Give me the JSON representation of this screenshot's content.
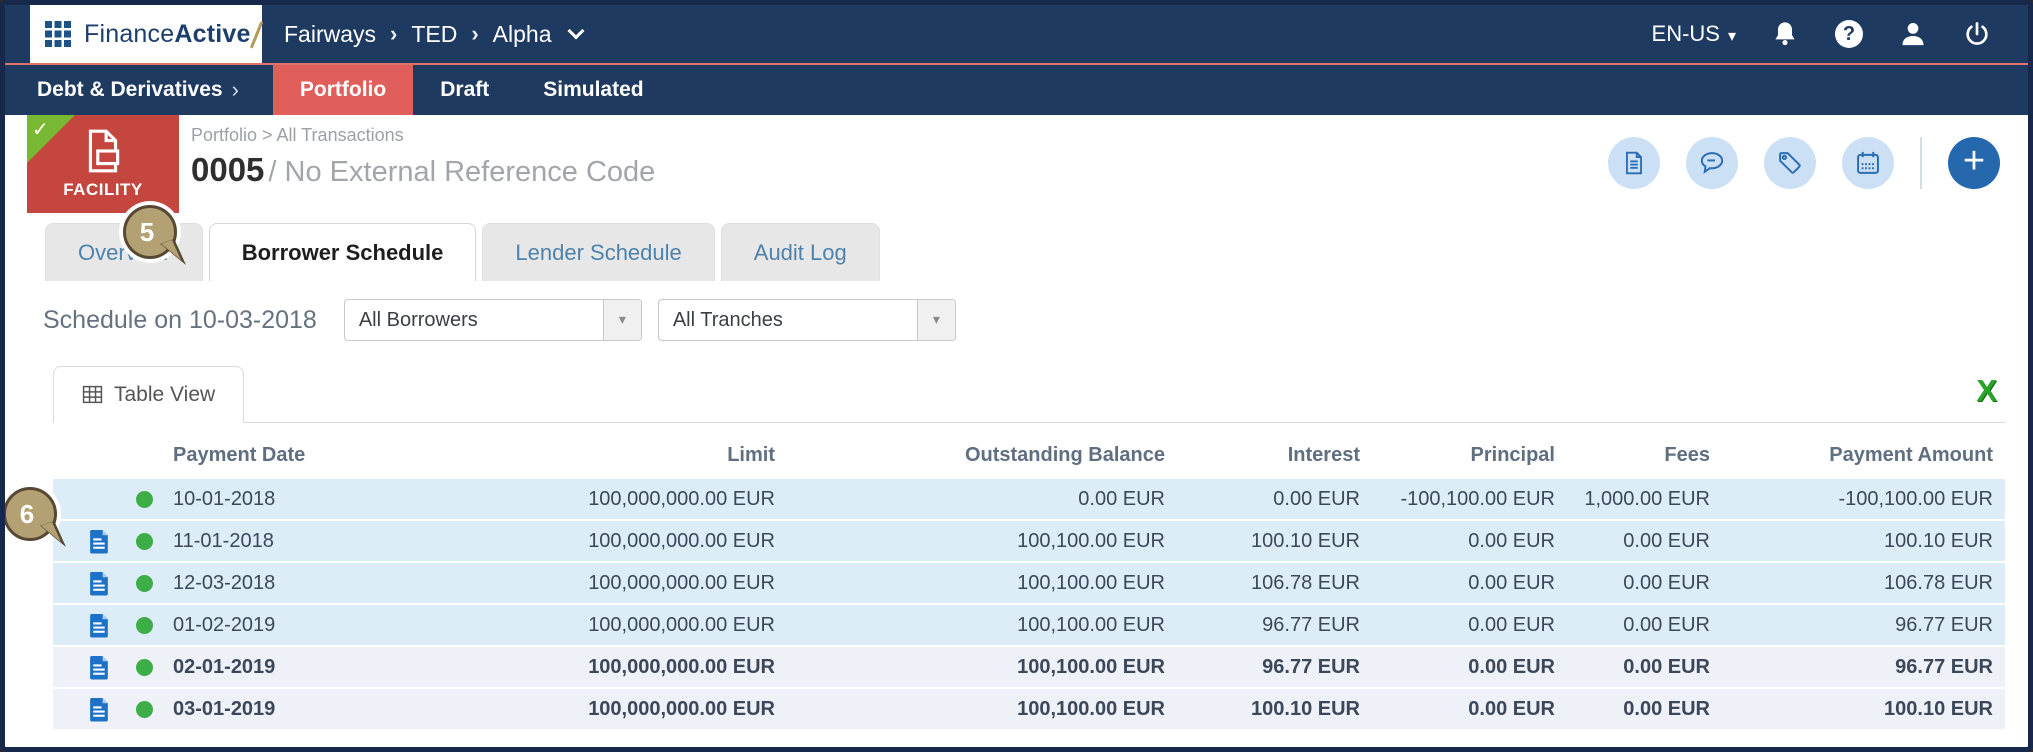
{
  "colors": {
    "navy": "#1f3a61",
    "module_active_red": "#e05f5a",
    "facility_red": "#c5463f",
    "ribbon_green": "#79b832",
    "status_dot_green": "#3dae47",
    "tab_link_blue": "#4d82ad",
    "icon_blue": "#2a6db5",
    "row_highlight_blue": "#ddedf8",
    "excel_green": "#28a428",
    "annotation_tan": "#b3a173"
  },
  "topnav": {
    "logo_finance": "Finance",
    "logo_active": "Active",
    "breadcrumb": [
      "Fairways",
      "TED",
      "Alpha"
    ],
    "language_label": "EN-US",
    "icons": [
      "notifications-bell",
      "help",
      "user",
      "power"
    ]
  },
  "modulenav": {
    "module_label": "Debt & Derivatives",
    "tabs": [
      {
        "label": "Portfolio",
        "active": true
      },
      {
        "label": "Draft",
        "active": false
      },
      {
        "label": "Simulated",
        "active": false
      }
    ]
  },
  "facility": {
    "type_label": "FACILITY",
    "breadcrumb": "Portfolio > All Transactions",
    "code": "0005",
    "name": "/ No External Reference Code",
    "action_icons": [
      "document",
      "comment",
      "tag",
      "calendar",
      "add"
    ]
  },
  "annotation_badges": {
    "tabs_badge": "5",
    "rows_badge": "6"
  },
  "page_tabs": [
    {
      "label": "Overview",
      "active": false
    },
    {
      "label": "Borrower Schedule",
      "active": true
    },
    {
      "label": "Lender Schedule",
      "active": false
    },
    {
      "label": "Audit Log",
      "active": false
    }
  ],
  "filters": {
    "schedule_label": "Schedule on 10-03-2018",
    "borrowers_value": "All Borrowers",
    "tranches_value": "All Tranches"
  },
  "view": {
    "table_view_label": "Table View",
    "excel_label": "X"
  },
  "schedule_table": {
    "columns": [
      "Payment Date",
      "Limit",
      "Outstanding Balance",
      "Interest",
      "Principal",
      "Fees",
      "Payment Amount"
    ],
    "rows": [
      {
        "payment_date": "10-01-2018",
        "limit": "100,000,000.00 EUR",
        "outstanding_balance": "0.00 EUR",
        "interest": "0.00 EUR",
        "principal": "-100,100.00 EUR",
        "fees": "1,000.00 EUR",
        "payment_amount": "-100,100.00 EUR",
        "has_document": false,
        "emphasized": false
      },
      {
        "payment_date": "11-01-2018",
        "limit": "100,000,000.00 EUR",
        "outstanding_balance": "100,100.00 EUR",
        "interest": "100.10 EUR",
        "principal": "0.00 EUR",
        "fees": "0.00 EUR",
        "payment_amount": "100.10 EUR",
        "has_document": true,
        "emphasized": false
      },
      {
        "payment_date": "12-03-2018",
        "limit": "100,000,000.00 EUR",
        "outstanding_balance": "100,100.00 EUR",
        "interest": "106.78 EUR",
        "principal": "0.00 EUR",
        "fees": "0.00 EUR",
        "payment_amount": "106.78 EUR",
        "has_document": true,
        "emphasized": false
      },
      {
        "payment_date": "01-02-2019",
        "limit": "100,000,000.00 EUR",
        "outstanding_balance": "100,100.00 EUR",
        "interest": "96.77 EUR",
        "principal": "0.00 EUR",
        "fees": "0.00 EUR",
        "payment_amount": "96.77 EUR",
        "has_document": true,
        "emphasized": false
      },
      {
        "payment_date": "02-01-2019",
        "limit": "100,000,000.00 EUR",
        "outstanding_balance": "100,100.00 EUR",
        "interest": "96.77 EUR",
        "principal": "0.00 EUR",
        "fees": "0.00 EUR",
        "payment_amount": "96.77 EUR",
        "has_document": true,
        "emphasized": true
      },
      {
        "payment_date": "03-01-2019",
        "limit": "100,000,000.00 EUR",
        "outstanding_balance": "100,100.00 EUR",
        "interest": "100.10 EUR",
        "principal": "0.00 EUR",
        "fees": "0.00 EUR",
        "payment_amount": "100.10 EUR",
        "has_document": true,
        "emphasized": true
      }
    ]
  }
}
